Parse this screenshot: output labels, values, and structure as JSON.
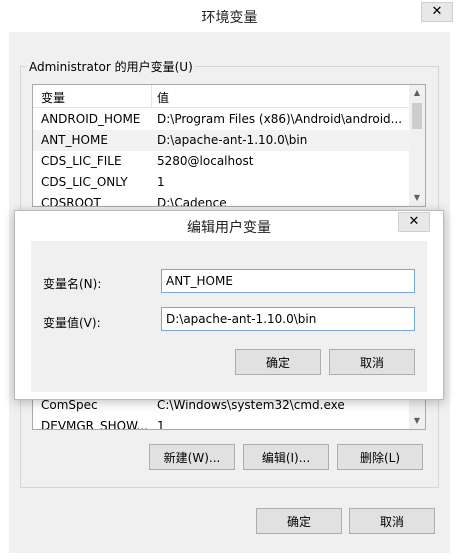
{
  "window": {
    "title": "环境变量",
    "close": "✕"
  },
  "user_group": {
    "label": "Administrator 的用户变量(U)",
    "columns": [
      "变量",
      "值"
    ],
    "rows": [
      {
        "name": "ANDROID_HOME",
        "value": "D:\\Program Files (x86)\\Android\\android..."
      },
      {
        "name": "ANT_HOME",
        "value": "D:\\apache-ant-1.10.0\\bin"
      },
      {
        "name": "CDS_LIC_FILE",
        "value": "5280@localhost"
      },
      {
        "name": "CDS_LIC_ONLY",
        "value": "1"
      },
      {
        "name": "CDSROOT",
        "value": "D:\\Cadence"
      }
    ],
    "selected_row": 1
  },
  "system_list": {
    "rows": [
      {
        "name": "ComSpec",
        "value": "C:\\Windows\\system32\\cmd.exe"
      },
      {
        "name": "DEVMGR_SHOW...",
        "value": "1"
      }
    ]
  },
  "system_buttons": {
    "new": "新建(W)...",
    "edit": "编辑(I)...",
    "delete": "删除(L)"
  },
  "footer_buttons": {
    "ok": "确定",
    "cancel": "取消"
  },
  "dialog": {
    "title": "编辑用户变量",
    "close": "✕",
    "name_label": "变量名(N):",
    "name_value": "ANT_HOME",
    "value_label": "变量值(V):",
    "value_value": "D:\\apache-ant-1.10.0\\bin",
    "ok": "确定",
    "cancel": "取消"
  }
}
